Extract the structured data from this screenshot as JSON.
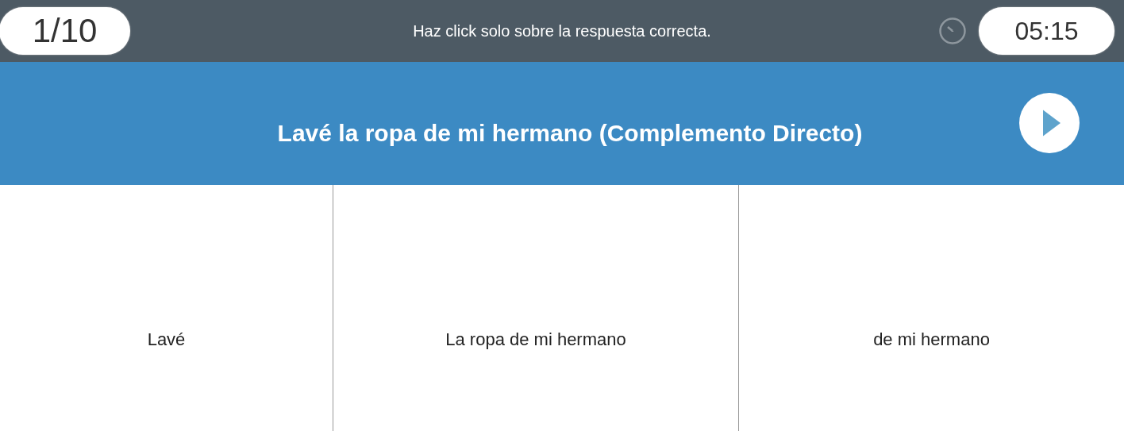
{
  "progress": "1/10",
  "instruction": "Haz click solo sobre la respuesta correcta.",
  "timer": "05:15",
  "question": "Lavé la ropa de mi hermano (Complemento Directo)",
  "answers": [
    {
      "label": "Lavé"
    },
    {
      "label": "La ropa de mi hermano"
    },
    {
      "label": "de mi hermano"
    }
  ]
}
